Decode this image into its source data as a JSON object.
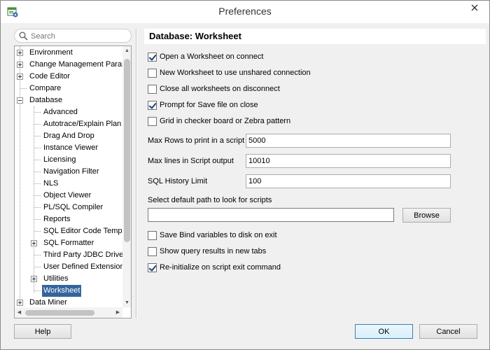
{
  "window": {
    "title": "Preferences"
  },
  "search": {
    "placeholder": "Search",
    "value": ""
  },
  "tree": {
    "items": [
      {
        "label": "Environment",
        "level": 0,
        "expander": "plus"
      },
      {
        "label": "Change Management Parar",
        "level": 0,
        "expander": "plus"
      },
      {
        "label": "Code Editor",
        "level": 0,
        "expander": "plus"
      },
      {
        "label": "Compare",
        "level": 0,
        "expander": "none"
      },
      {
        "label": "Database",
        "level": 0,
        "expander": "minus"
      },
      {
        "label": "Advanced",
        "level": 1,
        "expander": "none"
      },
      {
        "label": "Autotrace/Explain Plan",
        "level": 1,
        "expander": "none"
      },
      {
        "label": "Drag And Drop",
        "level": 1,
        "expander": "none"
      },
      {
        "label": "Instance Viewer",
        "level": 1,
        "expander": "none"
      },
      {
        "label": "Licensing",
        "level": 1,
        "expander": "none"
      },
      {
        "label": "Navigation Filter",
        "level": 1,
        "expander": "none"
      },
      {
        "label": "NLS",
        "level": 1,
        "expander": "none"
      },
      {
        "label": "Object Viewer",
        "level": 1,
        "expander": "none"
      },
      {
        "label": "PL/SQL Compiler",
        "level": 1,
        "expander": "none"
      },
      {
        "label": "Reports",
        "level": 1,
        "expander": "none"
      },
      {
        "label": "SQL Editor Code Templa",
        "level": 1,
        "expander": "none"
      },
      {
        "label": "SQL Formatter",
        "level": 1,
        "expander": "plus"
      },
      {
        "label": "Third Party JDBC Driver",
        "level": 1,
        "expander": "none"
      },
      {
        "label": "User Defined Extension",
        "level": 1,
        "expander": "none"
      },
      {
        "label": "Utilities",
        "level": 1,
        "expander": "plus"
      },
      {
        "label": "Worksheet",
        "level": 1,
        "expander": "none",
        "selected": true
      },
      {
        "label": "Data Miner",
        "level": 0,
        "expander": "plus"
      }
    ]
  },
  "panel": {
    "title": "Database: Worksheet",
    "options_top": [
      {
        "label": "Open a Worksheet on connect",
        "checked": true
      },
      {
        "label": "New Worksheet to use unshared connection",
        "checked": false
      },
      {
        "label": "Close all worksheets on disconnect",
        "checked": false
      },
      {
        "label": "Prompt for Save file on close",
        "checked": true
      },
      {
        "label": "Grid in checker board or Zebra pattern",
        "checked": false
      }
    ],
    "fields": {
      "max_rows_label": "Max Rows to print in a script",
      "max_rows_value": "5000",
      "max_lines_label": "Max lines in Script output",
      "max_lines_value": "10010",
      "history_label": "SQL History Limit",
      "history_value": "100",
      "path_label": "Select default path to look for scripts",
      "path_value": ""
    },
    "browse_label": "Browse",
    "options_bottom": [
      {
        "label": "Save Bind variables to disk on exit",
        "checked": false
      },
      {
        "label": "Show query results in new tabs",
        "checked": false
      },
      {
        "label": "Re-initialize on script exit command",
        "checked": true
      }
    ]
  },
  "footer": {
    "help_label": "Help",
    "ok_label": "OK",
    "cancel_label": "Cancel"
  },
  "colors": {
    "selection": "#33659c",
    "check": "#1a3f7a"
  }
}
